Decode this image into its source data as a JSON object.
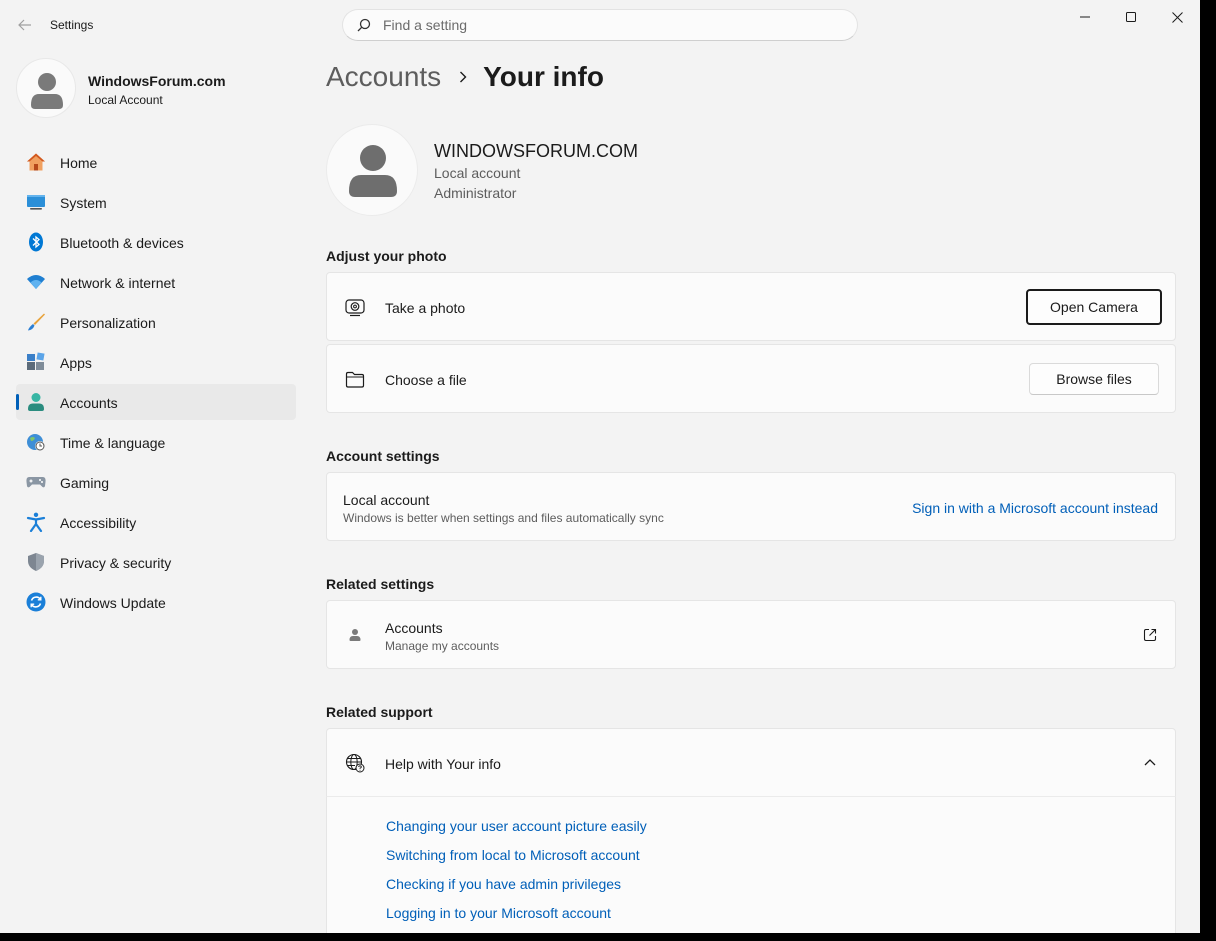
{
  "window": {
    "app_title": "Settings",
    "search_placeholder": "Find a setting"
  },
  "profile": {
    "name": "WindowsForum.com",
    "account_type": "Local Account"
  },
  "sidebar": {
    "items": [
      {
        "label": "Home",
        "icon": "home-icon"
      },
      {
        "label": "System",
        "icon": "system-icon"
      },
      {
        "label": "Bluetooth & devices",
        "icon": "bluetooth-icon"
      },
      {
        "label": "Network & internet",
        "icon": "wifi-icon"
      },
      {
        "label": "Personalization",
        "icon": "brush-icon"
      },
      {
        "label": "Apps",
        "icon": "apps-icon"
      },
      {
        "label": "Accounts",
        "icon": "accounts-icon",
        "active": true
      },
      {
        "label": "Time & language",
        "icon": "globe-clock-icon"
      },
      {
        "label": "Gaming",
        "icon": "gamepad-icon"
      },
      {
        "label": "Accessibility",
        "icon": "accessibility-icon"
      },
      {
        "label": "Privacy & security",
        "icon": "shield-icon"
      },
      {
        "label": "Windows Update",
        "icon": "update-icon"
      }
    ]
  },
  "breadcrumb": {
    "parent": "Accounts",
    "current": "Your info"
  },
  "user": {
    "name": "WINDOWSFORUM.COM",
    "line1": "Local account",
    "line2": "Administrator"
  },
  "adjust_photo": {
    "title": "Adjust your photo",
    "take_photo_label": "Take a photo",
    "open_camera_label": "Open Camera",
    "choose_file_label": "Choose a file",
    "browse_files_label": "Browse files"
  },
  "account_settings": {
    "title": "Account settings",
    "local_title": "Local account",
    "local_sub": "Windows is better when settings and files automatically sync",
    "sign_in_link": "Sign in with a Microsoft account instead"
  },
  "related_settings": {
    "title": "Related settings",
    "accounts_title": "Accounts",
    "accounts_sub": "Manage my accounts"
  },
  "related_support": {
    "title": "Related support",
    "help_title": "Help with Your info",
    "links": [
      "Changing your user account picture easily",
      "Switching from local to Microsoft account",
      "Checking if you have admin privileges",
      "Logging in to your Microsoft account"
    ]
  },
  "colors": {
    "accent": "#005fb8",
    "window_bg": "#f3f3f3",
    "card_bg": "#fbfbfb"
  }
}
